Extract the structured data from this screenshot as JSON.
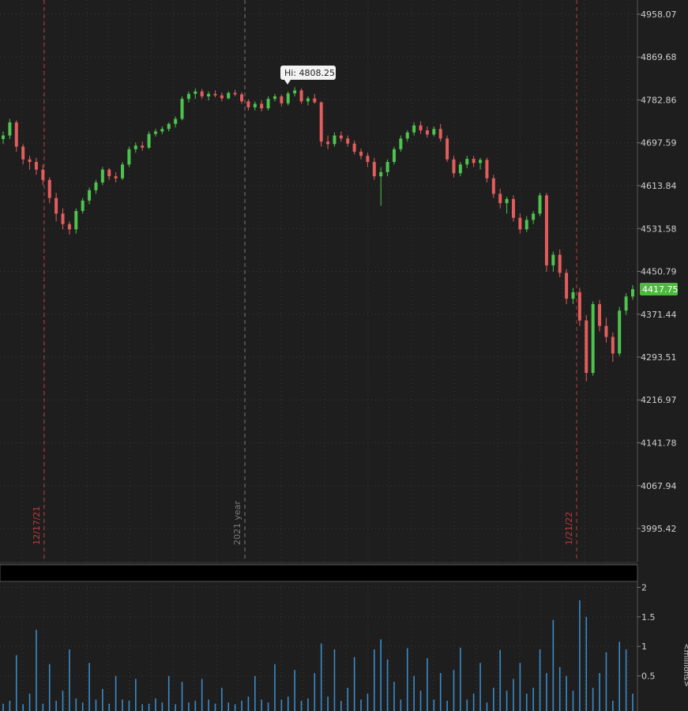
{
  "theme": {
    "background": "#1e1e1e",
    "grid": "#3a3a3a",
    "axis": "#8a8a8a",
    "up": "#4ec34e",
    "down": "#e35d5d",
    "volume": "#3a8bc7",
    "marker": "#c03a3a",
    "year_marker": "#7a7a7a",
    "last_price_bg": "#4cbb3c"
  },
  "price_axis": {
    "ticks": [
      "4958.07",
      "4869.68",
      "4782.86",
      "4697.59",
      "4613.84",
      "4531.58",
      "4450.79",
      "4371.44",
      "4293.51",
      "4216.97",
      "4141.78",
      "4067.94",
      "3995.42"
    ],
    "scale": "log",
    "ylim": [
      3950,
      4990
    ]
  },
  "last_price": {
    "label": "4417.75",
    "value": 4417.75
  },
  "hi_bubble": {
    "label": "Hi: 4808.25",
    "value": 4808.25
  },
  "vertical_markers": [
    {
      "label": "12/17/21",
      "kind": "date"
    },
    {
      "label": "2021 year",
      "kind": "year"
    },
    {
      "label": "1/21/22",
      "kind": "date"
    }
  ],
  "volume_axis": {
    "ticks": [
      "2",
      "1.5",
      "1",
      "0.5"
    ],
    "tick_values": [
      2,
      1.5,
      1,
      0.5
    ],
    "unit_label": "<millions>",
    "ylim": [
      0,
      2.1
    ]
  },
  "chart_data": {
    "type": "candlestick",
    "scale": "log",
    "bars": [
      [
        4705,
        4720,
        4695,
        4712
      ],
      [
        4712,
        4745,
        4705,
        4738
      ],
      [
        4738,
        4742,
        4680,
        4690
      ],
      [
        4690,
        4695,
        4655,
        4665
      ],
      [
        4665,
        4672,
        4645,
        4660
      ],
      [
        4660,
        4668,
        4635,
        4645
      ],
      [
        4645,
        4655,
        4615,
        4625
      ],
      [
        4625,
        4630,
        4580,
        4590
      ],
      [
        4590,
        4600,
        4545,
        4560
      ],
      [
        4560,
        4570,
        4530,
        4540
      ],
      [
        4540,
        4545,
        4520,
        4530
      ],
      [
        4530,
        4570,
        4522,
        4565
      ],
      [
        4565,
        4590,
        4560,
        4585
      ],
      [
        4585,
        4610,
        4578,
        4605
      ],
      [
        4605,
        4625,
        4598,
        4620
      ],
      [
        4620,
        4650,
        4615,
        4645
      ],
      [
        4645,
        4648,
        4625,
        4632
      ],
      [
        4632,
        4640,
        4620,
        4628
      ],
      [
        4628,
        4660,
        4625,
        4655
      ],
      [
        4655,
        4690,
        4650,
        4685
      ],
      [
        4685,
        4698,
        4678,
        4692
      ],
      [
        4692,
        4700,
        4682,
        4688
      ],
      [
        4688,
        4720,
        4685,
        4715
      ],
      [
        4715,
        4725,
        4710,
        4720
      ],
      [
        4720,
        4730,
        4715,
        4725
      ],
      [
        4725,
        4738,
        4720,
        4735
      ],
      [
        4735,
        4750,
        4728,
        4745
      ],
      [
        4745,
        4790,
        4742,
        4785
      ],
      [
        4785,
        4800,
        4778,
        4795
      ],
      [
        4795,
        4806,
        4785,
        4800
      ],
      [
        4800,
        4805,
        4785,
        4790
      ],
      [
        4790,
        4800,
        4782,
        4795
      ],
      [
        4795,
        4802,
        4788,
        4792
      ],
      [
        4792,
        4798,
        4780,
        4786
      ],
      [
        4786,
        4800,
        4784,
        4797
      ],
      [
        4797,
        4803,
        4790,
        4794
      ],
      [
        4794,
        4798,
        4775,
        4780
      ],
      [
        4780,
        4784,
        4762,
        4768
      ],
      [
        4768,
        4780,
        4762,
        4775
      ],
      [
        4775,
        4782,
        4760,
        4766
      ],
      [
        4766,
        4790,
        4762,
        4785
      ],
      [
        4785,
        4795,
        4780,
        4790
      ],
      [
        4790,
        4794,
        4770,
        4776
      ],
      [
        4776,
        4800,
        4772,
        4796
      ],
      [
        4796,
        4808.25,
        4790,
        4802
      ],
      [
        4802,
        4806,
        4775,
        4780
      ],
      [
        4780,
        4790,
        4772,
        4786
      ],
      [
        4786,
        4795,
        4775,
        4778
      ],
      [
        4778,
        4780,
        4690,
        4700
      ],
      [
        4700,
        4712,
        4685,
        4695
      ],
      [
        4695,
        4718,
        4690,
        4712
      ],
      [
        4712,
        4720,
        4700,
        4706
      ],
      [
        4706,
        4712,
        4690,
        4696
      ],
      [
        4696,
        4702,
        4675,
        4680
      ],
      [
        4680,
        4686,
        4665,
        4672
      ],
      [
        4672,
        4678,
        4650,
        4660
      ],
      [
        4660,
        4668,
        4625,
        4632
      ],
      [
        4632,
        4650,
        4575,
        4640
      ],
      [
        4640,
        4665,
        4632,
        4660
      ],
      [
        4660,
        4690,
        4655,
        4685
      ],
      [
        4685,
        4712,
        4680,
        4706
      ],
      [
        4706,
        4722,
        4700,
        4718
      ],
      [
        4718,
        4738,
        4712,
        4732
      ],
      [
        4732,
        4740,
        4715,
        4722
      ],
      [
        4722,
        4730,
        4708,
        4714
      ],
      [
        4714,
        4730,
        4710,
        4725
      ],
      [
        4725,
        4735,
        4700,
        4706
      ],
      [
        4706,
        4712,
        4660,
        4665
      ],
      [
        4665,
        4672,
        4630,
        4638
      ],
      [
        4638,
        4660,
        4632,
        4655
      ],
      [
        4655,
        4672,
        4648,
        4666
      ],
      [
        4666,
        4672,
        4650,
        4658
      ],
      [
        4658,
        4668,
        4645,
        4664
      ],
      [
        4664,
        4668,
        4620,
        4628
      ],
      [
        4628,
        4635,
        4590,
        4598
      ],
      [
        4598,
        4608,
        4570,
        4580
      ],
      [
        4580,
        4592,
        4560,
        4588
      ],
      [
        4588,
        4595,
        4545,
        4552
      ],
      [
        4552,
        4560,
        4522,
        4530
      ],
      [
        4530,
        4555,
        4525,
        4548
      ],
      [
        4548,
        4565,
        4540,
        4560
      ],
      [
        4560,
        4600,
        4555,
        4595
      ],
      [
        4595,
        4600,
        4450,
        4462
      ],
      [
        4462,
        4488,
        4450,
        4482
      ],
      [
        4482,
        4492,
        4440,
        4448
      ],
      [
        4448,
        4455,
        4390,
        4400
      ],
      [
        4400,
        4420,
        4390,
        4412
      ],
      [
        4412,
        4420,
        4350,
        4360
      ],
      [
        4360,
        4370,
        4250,
        4265
      ],
      [
        4265,
        4395,
        4260,
        4390
      ],
      [
        4390,
        4398,
        4340,
        4350
      ],
      [
        4350,
        4365,
        4320,
        4330
      ],
      [
        4330,
        4338,
        4285,
        4300
      ],
      [
        4300,
        4385,
        4295,
        4378
      ],
      [
        4378,
        4410,
        4370,
        4404
      ],
      [
        4404,
        4425,
        4398,
        4417.75
      ]
    ],
    "volume": [
      0.03,
      0.08,
      0.85,
      0.02,
      0.2,
      1.28,
      0.03,
      0.7,
      0.08,
      0.25,
      0.95,
      0.12,
      0.05,
      0.72,
      0.1,
      0.28,
      0.03,
      0.5,
      0.1,
      0.08,
      0.45,
      0.02,
      0.03,
      0.12,
      0.05,
      0.5,
      0.02,
      0.4,
      0.05,
      0.08,
      0.45,
      0.1,
      0.03,
      0.3,
      0.05,
      0.02,
      0.08,
      0.15,
      0.5,
      0.1,
      0.05,
      0.7,
      0.1,
      0.15,
      0.6,
      0.08,
      0.12,
      0.55,
      1.05,
      0.15,
      0.95,
      0.08,
      0.3,
      0.82,
      0.1,
      0.2,
      0.95,
      1.12,
      0.78,
      0.4,
      0.1,
      0.97,
      0.5,
      0.25,
      0.8,
      0.1,
      0.55,
      0.08,
      0.6,
      0.98,
      0.1,
      0.2,
      0.72,
      0.05,
      0.3,
      0.94,
      0.25,
      0.45,
      0.72,
      0.2,
      0.3,
      0.95,
      0.55,
      1.45,
      0.65,
      0.5,
      0.25,
      1.78,
      1.5,
      0.3,
      0.55,
      0.9,
      0.08,
      1.08,
      0.95,
      0.2
    ]
  }
}
